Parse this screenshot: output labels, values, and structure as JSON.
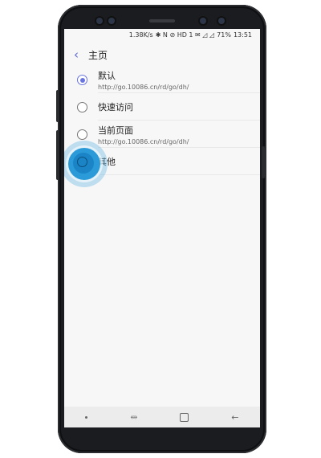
{
  "status": {
    "speed": "1.38K/s",
    "icons": "✱ N ⊘ HD 1 ✉ ◿ ◿ ",
    "battery": "71%",
    "time": "13:51"
  },
  "header": {
    "title": "主页"
  },
  "options": [
    {
      "label": "默认",
      "sub": "http://go.10086.cn/rd/go/dh/",
      "checked": true
    },
    {
      "label": "快速访问",
      "sub": "",
      "checked": false
    },
    {
      "label": "当前页面",
      "sub": "http://go.10086.cn/rd/go/dh/",
      "checked": false
    },
    {
      "label": "其他",
      "sub": "",
      "checked": false
    }
  ],
  "nav": {
    "recent": "⥈",
    "back": "←"
  },
  "colors": {
    "accent": "#6a74e0",
    "touch": "#1a84c6"
  }
}
